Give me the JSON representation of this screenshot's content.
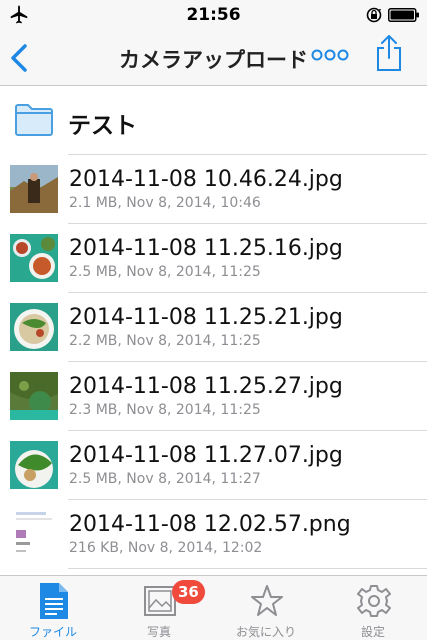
{
  "status_bar": {
    "time": "21:56",
    "icons": [
      "airplane-icon",
      "rotation-lock-icon",
      "battery-icon"
    ]
  },
  "nav": {
    "title": "カメラアップロード",
    "back_icon": "chevron-left-icon",
    "more_icon": "more-dots-icon",
    "share_icon": "share-icon"
  },
  "colors": {
    "accent": "#1e88e5",
    "badge": "#f04a3c",
    "meta_text": "#8e8e93"
  },
  "folder": {
    "name": "テスト",
    "icon": "folder-icon"
  },
  "files": [
    {
      "name": "2014-11-08 10.46.24.jpg",
      "meta": "2.1 MB, Nov 8, 2014, 10:46"
    },
    {
      "name": "2014-11-08 11.25.16.jpg",
      "meta": "2.5 MB, Nov 8, 2014, 11:25"
    },
    {
      "name": "2014-11-08 11.25.21.jpg",
      "meta": "2.2 MB, Nov 8, 2014, 11:25"
    },
    {
      "name": "2014-11-08 11.25.27.jpg",
      "meta": "2.3 MB, Nov 8, 2014, 11:25"
    },
    {
      "name": "2014-11-08 11.27.07.jpg",
      "meta": "2.5 MB, Nov 8, 2014, 11:27"
    },
    {
      "name": "2014-11-08 12.02.57.png",
      "meta": "216 KB, Nov 8, 2014, 12:02"
    }
  ],
  "tabs": [
    {
      "label": "ファイル",
      "icon": "document-icon",
      "active": true
    },
    {
      "label": "写真",
      "icon": "photo-icon",
      "badge": "36"
    },
    {
      "label": "お気に入り",
      "icon": "star-icon"
    },
    {
      "label": "設定",
      "icon": "gear-icon"
    }
  ]
}
